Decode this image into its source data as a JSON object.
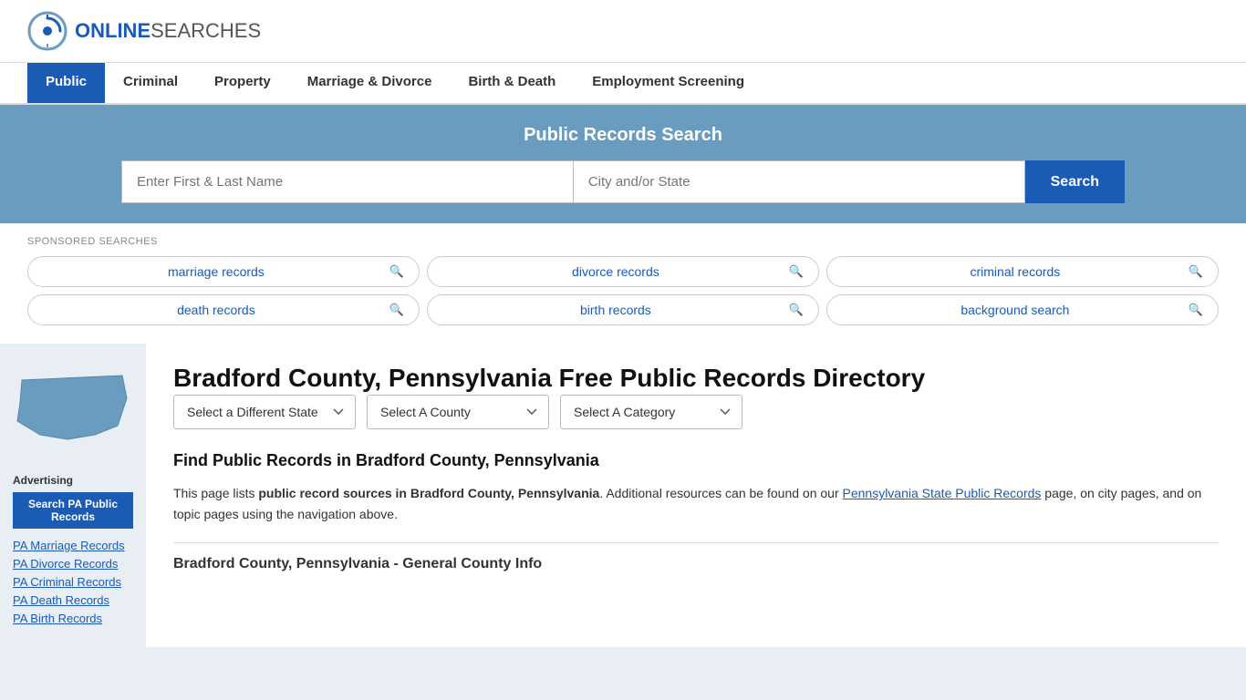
{
  "header": {
    "logo_online": "ONLINE",
    "logo_searches": "SEARCHES",
    "logo_alt": "OnlineSearches logo"
  },
  "nav": {
    "items": [
      {
        "label": "Public",
        "active": true
      },
      {
        "label": "Criminal",
        "active": false
      },
      {
        "label": "Property",
        "active": false
      },
      {
        "label": "Marriage & Divorce",
        "active": false
      },
      {
        "label": "Birth & Death",
        "active": false
      },
      {
        "label": "Employment Screening",
        "active": false
      }
    ]
  },
  "search_banner": {
    "title": "Public Records Search",
    "name_placeholder": "Enter First & Last Name",
    "location_placeholder": "City and/or State",
    "search_label": "Search"
  },
  "sponsored": {
    "label": "SPONSORED SEARCHES",
    "items": [
      {
        "text": "marriage records"
      },
      {
        "text": "divorce records"
      },
      {
        "text": "criminal records"
      },
      {
        "text": "death records"
      },
      {
        "text": "birth records"
      },
      {
        "text": "background search"
      }
    ]
  },
  "sidebar": {
    "advertising_label": "Advertising",
    "ad_button_label": "Search PA Public Records",
    "links": [
      {
        "text": "PA Marriage Records"
      },
      {
        "text": "PA Divorce Records"
      },
      {
        "text": "PA Criminal Records"
      },
      {
        "text": "PA Death Records"
      },
      {
        "text": "PA Birth Records"
      }
    ]
  },
  "content": {
    "page_title": "Bradford County, Pennsylvania Free Public Records Directory",
    "dropdowns": {
      "state_label": "Select a Different State",
      "county_label": "Select A County",
      "category_label": "Select A Category"
    },
    "find_title": "Find Public Records in Bradford County, Pennsylvania",
    "description_part1": "This page lists ",
    "description_bold1": "public record sources in Bradford County, Pennsylvania",
    "description_part2": ". Additional resources can be found on our ",
    "description_link": "Pennsylvania State Public Records",
    "description_part3": " page, on city pages, and on topic pages using the navigation above.",
    "county_info_title": "Bradford County, Pennsylvania - General County Info"
  }
}
